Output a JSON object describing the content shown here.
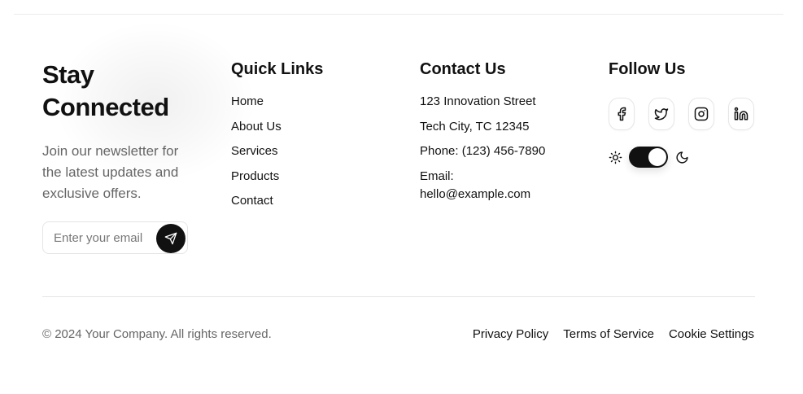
{
  "brand": {
    "title_line1": "Stay",
    "title_line2": "Connected",
    "description": "Join our newsletter for the latest updates and exclusive offers."
  },
  "newsletter": {
    "placeholder": "Enter your email",
    "submit_icon": "send-icon"
  },
  "quick_links": {
    "heading": "Quick Links",
    "items": [
      "Home",
      "About Us",
      "Services",
      "Products",
      "Contact"
    ]
  },
  "contact": {
    "heading": "Contact Us",
    "street": "123 Innovation Street",
    "city": "Tech City, TC 12345",
    "phone": "Phone: (123) 456-7890",
    "email_label": "Email:",
    "email_value": "hello@example.com"
  },
  "follow": {
    "heading": "Follow Us",
    "socials": [
      "facebook-icon",
      "twitter-icon",
      "instagram-icon",
      "linkedin-icon"
    ],
    "theme_toggle": {
      "state": "dark",
      "left_icon": "sun-icon",
      "right_icon": "moon-icon"
    }
  },
  "footer": {
    "copyright": "© 2024 Your Company. All rights reserved.",
    "legal_links": [
      "Privacy Policy",
      "Terms of Service",
      "Cookie Settings"
    ]
  },
  "colors": {
    "text": "#111111",
    "muted": "#666666",
    "border": "#e5e5e5",
    "accent_dark": "#111111"
  }
}
